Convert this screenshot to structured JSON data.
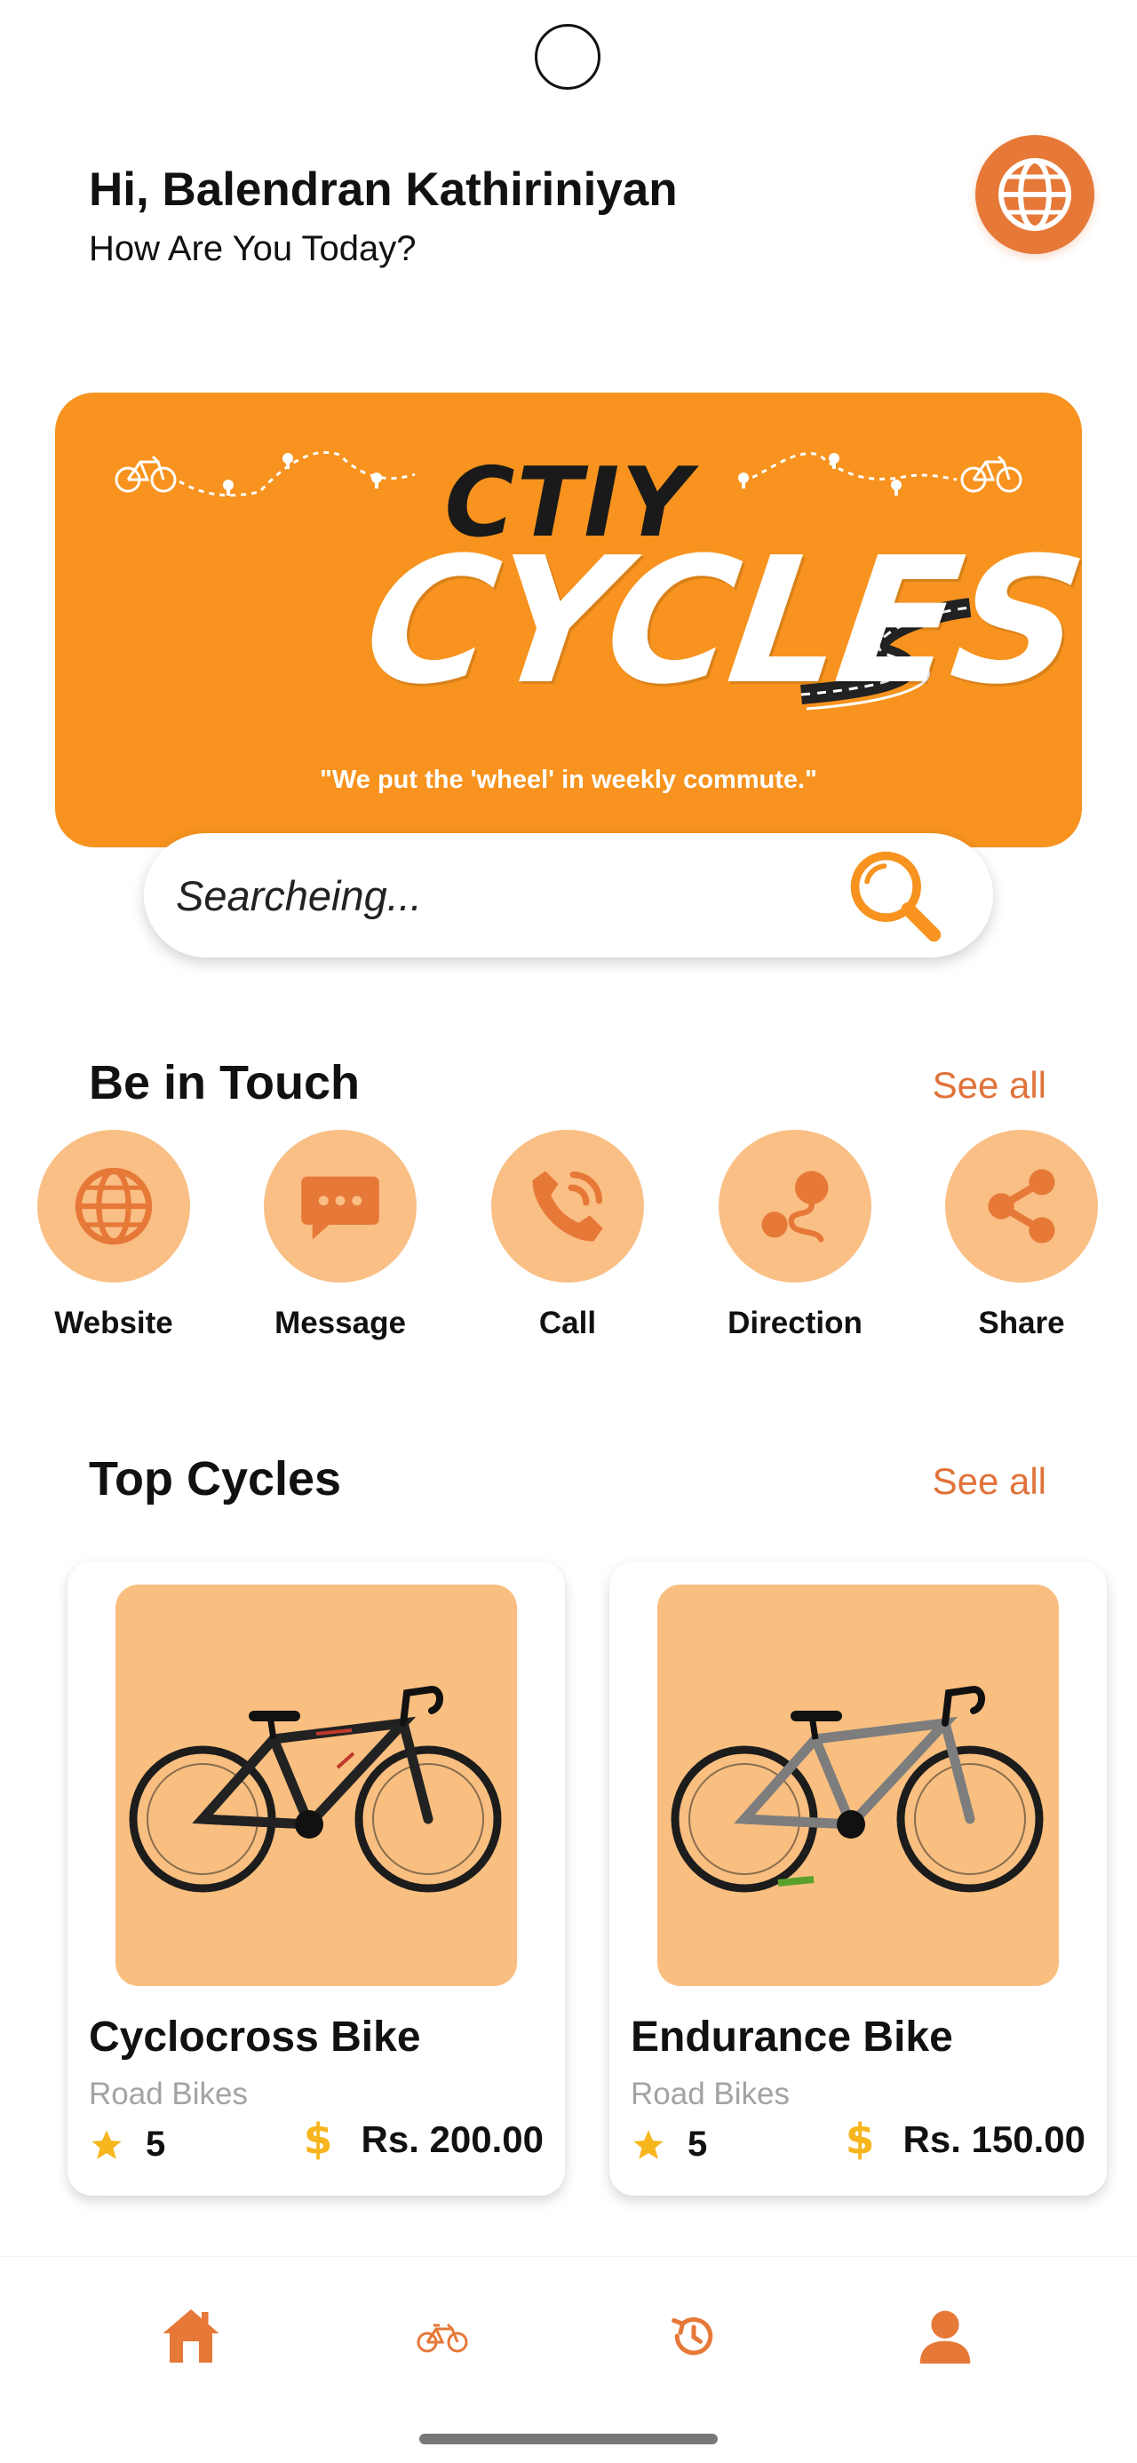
{
  "theme": {
    "accent": "#f7931e",
    "accent_dark": "#e67838",
    "accent_light": "#f9bf85",
    "star": "#f7b51e"
  },
  "header": {
    "greeting": "Hi, Balendran Kathiriniyan",
    "subtitle": "How Are You Today?",
    "avatar_icon": "globe-icon"
  },
  "banner": {
    "brand_top": "CTIY",
    "brand_main": "CYCLES",
    "tagline": "\"We put the 'wheel' in weekly commute.\""
  },
  "search": {
    "placeholder": "Searcheing...",
    "icon": "search-icon"
  },
  "be_in_touch": {
    "title": "Be in Touch",
    "see_all": "See all",
    "items": [
      {
        "label": "Website",
        "icon": "globe-icon"
      },
      {
        "label": "Message",
        "icon": "message-icon"
      },
      {
        "label": "Call",
        "icon": "phone-icon"
      },
      {
        "label": "Direction",
        "icon": "direction-icon"
      },
      {
        "label": "Share",
        "icon": "share-icon"
      }
    ]
  },
  "top_cycles": {
    "title": "Top Cycles",
    "see_all": "See all",
    "cards": [
      {
        "name": "Cyclocross Bike",
        "category": "Road Bikes",
        "rating": "5",
        "price": "Rs. 200.00"
      },
      {
        "name": "Endurance Bike",
        "category": "Road Bikes",
        "rating": "5",
        "price": "Rs. 150.00"
      }
    ]
  },
  "bottom_nav": {
    "items": [
      {
        "icon": "home-icon"
      },
      {
        "icon": "bicycle-icon"
      },
      {
        "icon": "history-icon"
      },
      {
        "icon": "profile-icon"
      }
    ]
  }
}
